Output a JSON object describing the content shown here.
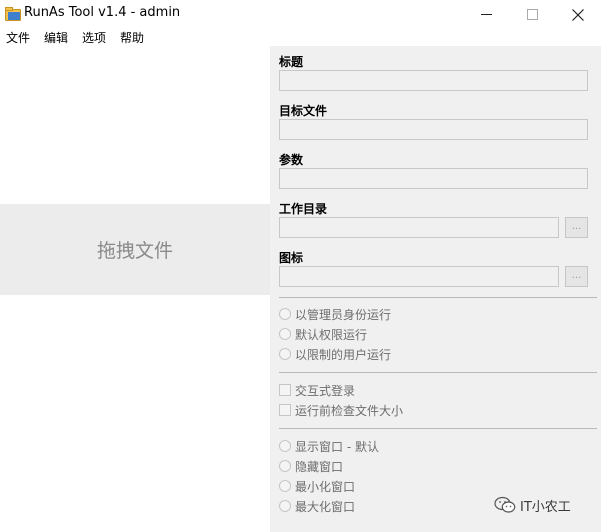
{
  "window": {
    "title": "RunAs Tool v1.4 - admin",
    "controls": {
      "minimize": "—",
      "maximize": "☐",
      "close": "✕"
    }
  },
  "menu": [
    "文件",
    "编辑",
    "选项",
    "帮助"
  ],
  "drop_zone": {
    "label": "拖拽文件"
  },
  "fields": {
    "title_label": "标题",
    "target_label": "目标文件",
    "args_label": "参数",
    "workdir_label": "工作目录",
    "icon_label": "图标",
    "browse_label": "..."
  },
  "run_mode": [
    "以管理员身份运行",
    "默认权限运行",
    "以限制的用户运行"
  ],
  "checks": [
    "交互式登录",
    "运行前检查文件大小"
  ],
  "window_mode": [
    "显示窗口 - 默认",
    "隐藏窗口",
    "最小化窗口",
    "最大化窗口"
  ],
  "watermark": {
    "text": "IT小农工",
    "icon": "wechat-icon"
  },
  "colors": {
    "panel_bg": "#f0f0f0",
    "drop_bg": "#ececec",
    "disabled_text": "#6d6d6d"
  }
}
